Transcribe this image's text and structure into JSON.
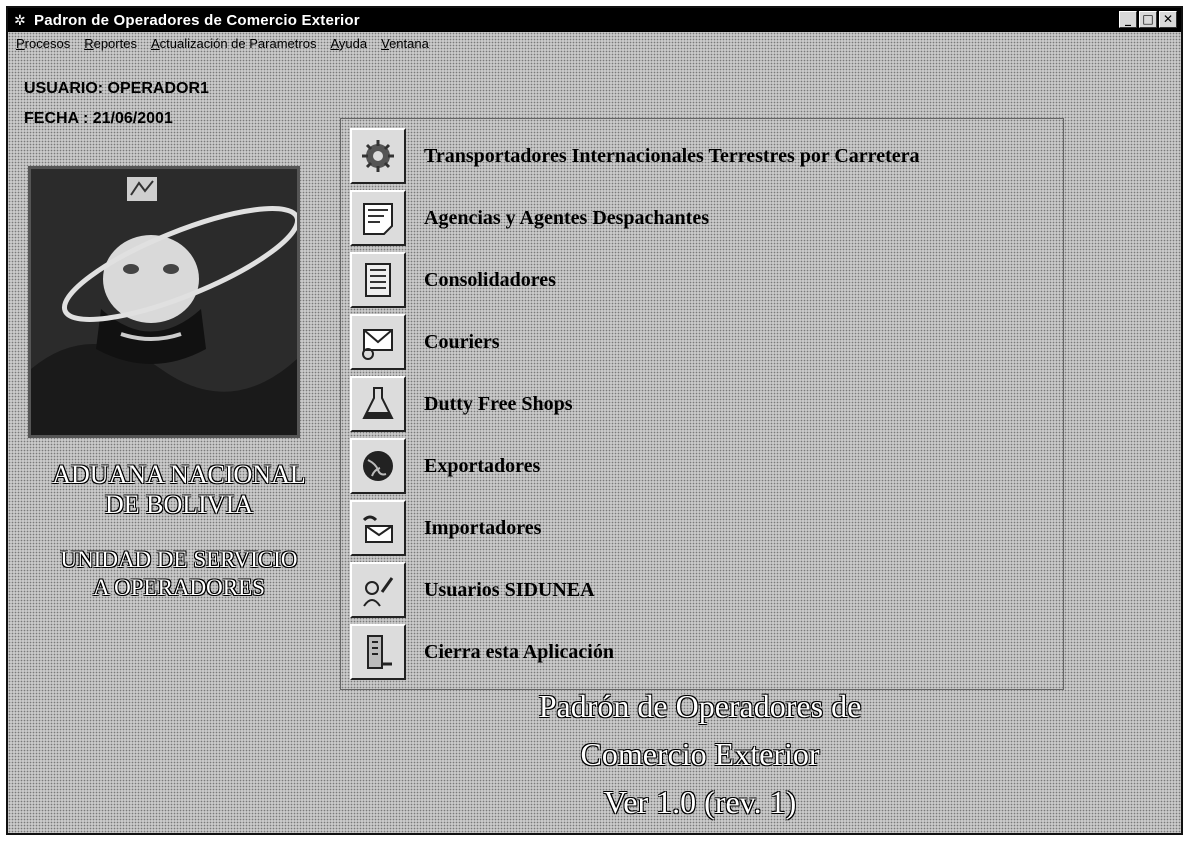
{
  "window": {
    "title": "Padron de Operadores de Comercio Exterior",
    "controls": [
      "minimize-icon",
      "maximize-icon",
      "close-icon"
    ]
  },
  "menu": [
    {
      "label": "Procesos"
    },
    {
      "label": "Reportes"
    },
    {
      "label": "Actualización de Parametros"
    },
    {
      "label": "Ayuda"
    },
    {
      "label": "Ventana"
    }
  ],
  "session": {
    "user": "USUARIO: OPERADOR1",
    "date": "FECHA  : 21/06/2001"
  },
  "organization": {
    "line1": "ADUANA NACIONAL",
    "line2": "DE BOLIVIA",
    "line3": "UNIDAD DE SERVICIO",
    "line4": "A OPERADORES"
  },
  "options": [
    {
      "label": "Transportadores Internacionales Terrestres por Carretera",
      "icon": "gear-truck-icon"
    },
    {
      "label": "Agencias y Agentes Despachantes",
      "icon": "document-icon"
    },
    {
      "label": "Consolidadores",
      "icon": "ledger-icon"
    },
    {
      "label": "Couriers",
      "icon": "envelope-icon"
    },
    {
      "label": "Dutty Free Shops",
      "icon": "flask-icon"
    },
    {
      "label": "Exportadores",
      "icon": "globe-icon"
    },
    {
      "label": "Importadores",
      "icon": "mail-hand-icon"
    },
    {
      "label": "Usuarios SIDUNEA",
      "icon": "user-pen-icon"
    },
    {
      "label": "Cierra esta Aplicación",
      "icon": "exit-door-icon"
    }
  ],
  "about": {
    "line1": "Padrón de Operadores de",
    "line2": "Comercio Exterior",
    "line3": "Ver 1.0  (rev. 1)"
  }
}
